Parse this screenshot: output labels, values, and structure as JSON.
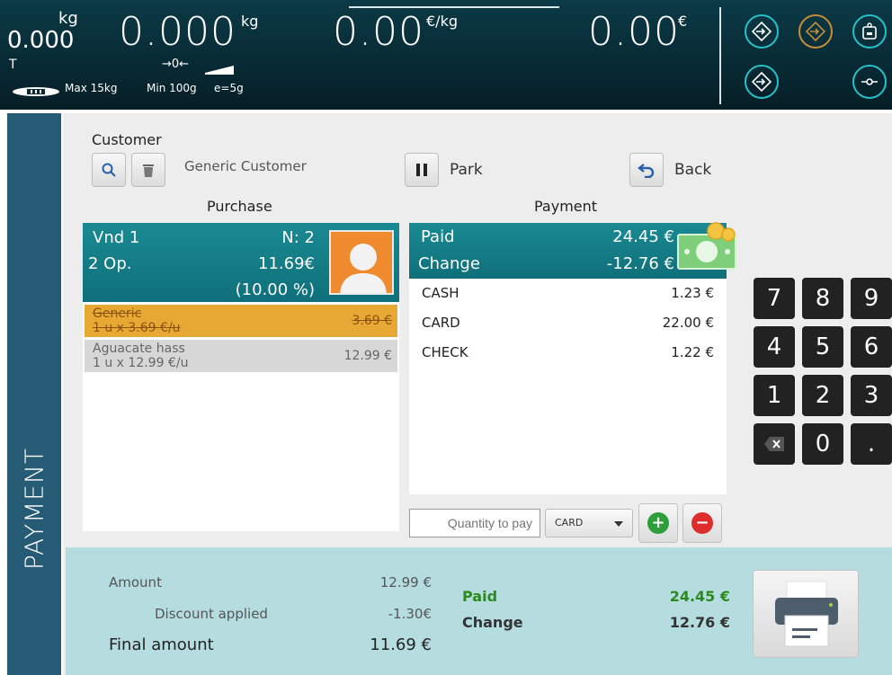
{
  "scale": {
    "tare_value": "0.000",
    "tare_unit": "kg",
    "tare_flag": "T",
    "weight": "0.000",
    "weight_unit": "kg",
    "price_per_kg": "0.00",
    "price_unit": "€/kg",
    "total_price": "0.00",
    "total_unit": "€",
    "zero_indicator": "→0←",
    "max": "Max 15kg",
    "min": "Min 100g",
    "division": "e=5g"
  },
  "scale_buttons": {
    "icons": [
      "tare-icon",
      "preset-tare-icon",
      "scale-info-icon",
      "tare-icon-2",
      "zero-icon"
    ]
  },
  "sidebar": {
    "label": "PAYMENT"
  },
  "customer": {
    "title": "Customer",
    "name": "Generic Customer"
  },
  "actions": {
    "park_label": "Park",
    "back_label": "Back"
  },
  "purchase": {
    "title": "Purchase",
    "vendor": "Vnd 1",
    "ticket_number": "N: 2",
    "ops": "2 Op.",
    "total": "11.69€",
    "discount_pct": "(10.00 %)",
    "items": [
      {
        "name": "Generic",
        "detail": "1 u x 3.69 €/u",
        "price": "3.69 €",
        "status": "cancelled"
      },
      {
        "name": "Aguacate hass",
        "detail": "1 u x 12.99 €/u",
        "price": "12.99 €",
        "status": "active"
      }
    ]
  },
  "payment": {
    "title": "Payment",
    "paid_label": "Paid",
    "paid_value": "24.45 €",
    "change_label": "Change",
    "change_value": "-12.76 €",
    "methods": [
      {
        "name": "CASH",
        "amount": "1.23 €"
      },
      {
        "name": "CARD",
        "amount": "22.00 €"
      },
      {
        "name": "CHECK",
        "amount": "1.22 €"
      }
    ],
    "quantity_placeholder": "Quantity to pay",
    "method_selected": "CARD"
  },
  "keypad": {
    "keys": [
      "7",
      "8",
      "9",
      "4",
      "5",
      "6",
      "1",
      "2",
      "3",
      "⌫",
      "0",
      "."
    ]
  },
  "totals": {
    "amount_label": "Amount",
    "amount_value": "12.99 €",
    "discount_label": "Discount applied",
    "discount_value": "-1.30€",
    "final_label": "Final amount",
    "final_value": "11.69 €",
    "paid_label": "Paid",
    "paid_value": "24.45 €",
    "change_label": "Change",
    "change_value": "12.76 €"
  },
  "colors": {
    "teal_header": "#0f6f7a",
    "sidebar": "#255b74",
    "discount_item": "#e8a934",
    "totals_bg": "#b5dde0",
    "paid_green": "#2b8a1f"
  }
}
